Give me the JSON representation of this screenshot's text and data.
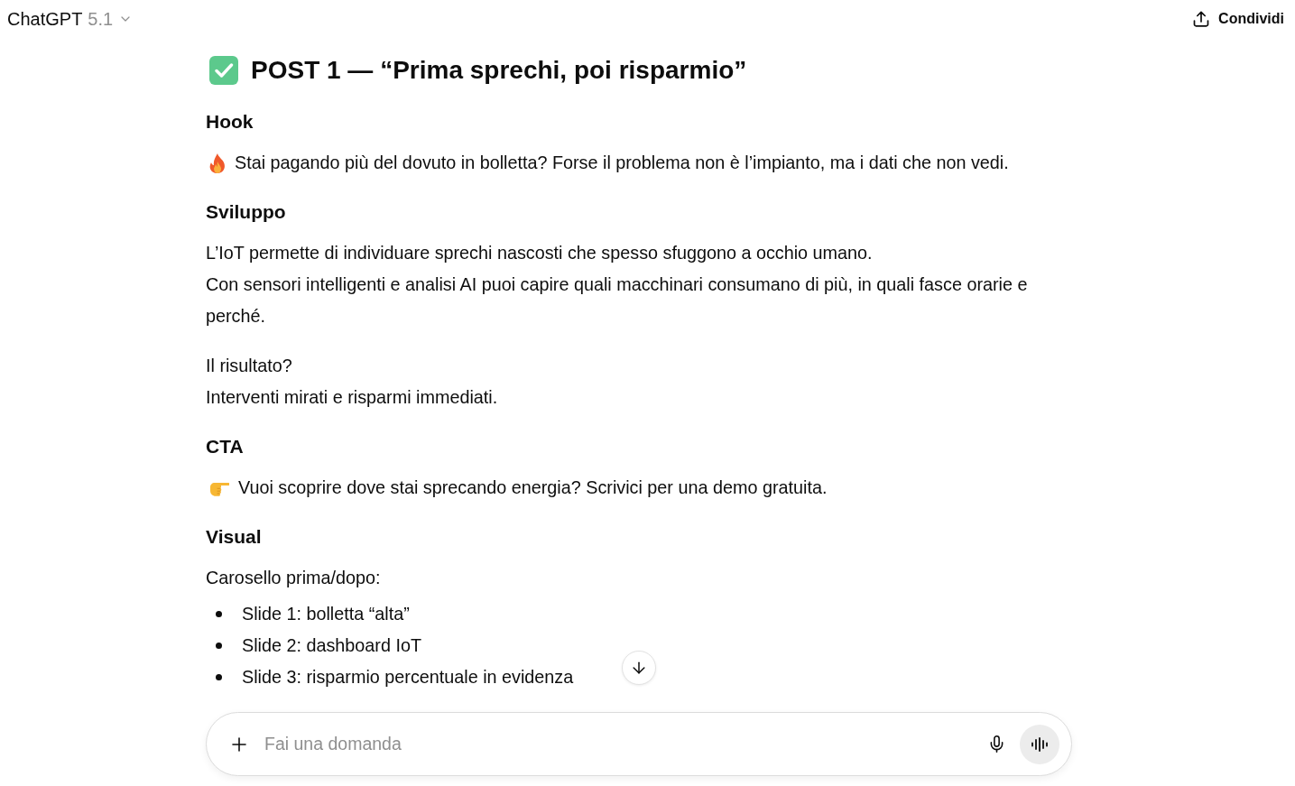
{
  "header": {
    "model_name": "ChatGPT",
    "model_version": "5.1",
    "share_label": "Condividi"
  },
  "post": {
    "title": "POST 1 — “Prima sprechi, poi risparmio”",
    "sections": [
      {
        "kind": "hook",
        "heading": "Hook",
        "text": "Stai pagando più del dovuto in bolletta? Forse il problema non è l’impianto, ma i dati che non vedi."
      },
      {
        "kind": "text",
        "heading": "Sviluppo",
        "paragraphs": [
          [
            "L’IoT permette di individuare sprechi nascosti che spesso sfuggono a occhio umano.",
            "Con sensori intelligenti e analisi AI puoi capire quali macchinari consumano di più, in quali fasce orarie e perché."
          ],
          [
            "Il risultato?",
            "Interventi mirati e risparmi immediati."
          ]
        ]
      },
      {
        "kind": "cta",
        "heading": "CTA",
        "text": "Vuoi scoprire dove stai sprecando energia? Scrivici per una demo gratuita."
      },
      {
        "kind": "list",
        "heading": "Visual",
        "intro": "Carosello prima/dopo:",
        "items": [
          "Slide 1: bolletta “alta”",
          "Slide 2: dashboard IoT",
          "Slide 3: risparmio percentuale in evidenza"
        ]
      }
    ]
  },
  "composer": {
    "placeholder": "Fai una domanda"
  }
}
